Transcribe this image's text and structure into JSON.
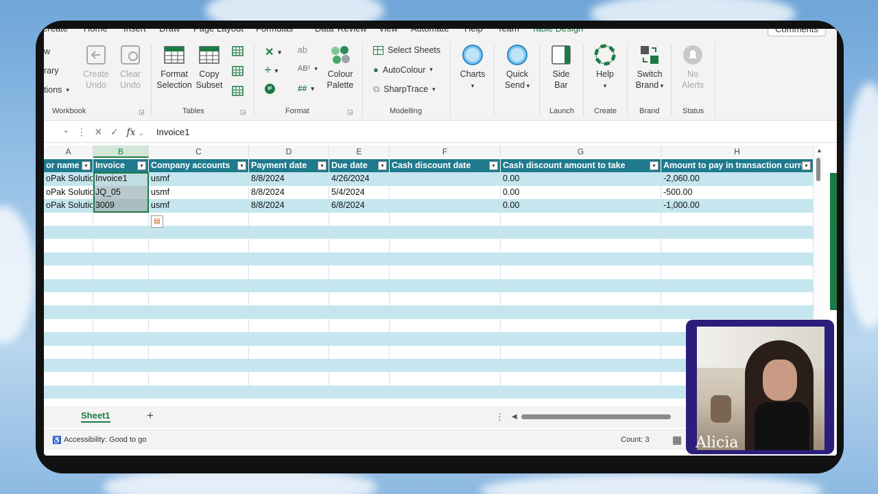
{
  "ribbon_tabs": [
    "Create",
    "Home",
    "Insert",
    "Draw",
    "Page Layout",
    "Formulas",
    "Data",
    "Review",
    "View",
    "Automate",
    "Help",
    "Team",
    "Table Design"
  ],
  "comments_label": "Comments",
  "left_partial": [
    "w",
    "rary",
    "tions"
  ],
  "groups": {
    "workbook": {
      "label": "Workbook",
      "create_undo": "Create\nUndo",
      "clear_undo": "Clear\nUndo"
    },
    "tables": {
      "label": "Tables",
      "format_selection": "Format\nSelection",
      "copy_subset": "Copy\nSubset"
    },
    "format": {
      "label": "Format",
      "colour_palette": "Colour\nPalette"
    },
    "modelling": {
      "label": "Modelling",
      "select_sheets": "Select Sheets",
      "autocolour": "AutoColour",
      "sharptrace": "SharpTrace",
      "charts": "Charts",
      "quick_send": "Quick\nSend"
    },
    "launch": {
      "label": "Launch",
      "side_bar": "Side\nBar"
    },
    "create": {
      "label": "Create",
      "help": "Help"
    },
    "brand": {
      "label": "Brand",
      "switch_brand": "Switch\nBrand"
    },
    "status": {
      "label": "Status",
      "no_alerts": "No\nAlerts"
    }
  },
  "formula": {
    "value": "Invoice1",
    "fx": "fx"
  },
  "columns": [
    "A",
    "B",
    "C",
    "D",
    "E",
    "F",
    "G",
    "H"
  ],
  "table": {
    "headers": [
      "or name",
      "Invoice",
      "Company accounts",
      "Payment date",
      "Due date",
      "Cash discount date",
      "Cash discount amount to take",
      "Amount to pay in transaction curren"
    ],
    "rows": [
      [
        "oPak Solution",
        "Invoice1",
        "usmf",
        "8/8/2024",
        "4/26/2024",
        "",
        "0.00",
        "-2,060.00"
      ],
      [
        "oPak Solution",
        "JQ_05",
        "usmf",
        "8/8/2024",
        "5/4/2024",
        "",
        "0.00",
        "-500.00"
      ],
      [
        "oPak Solution",
        "3009",
        "usmf",
        "8/8/2024",
        "6/8/2024",
        "",
        "0.00",
        "-1,000.00"
      ]
    ]
  },
  "sheet_tab": "Sheet1",
  "add_sheet": "+",
  "status": {
    "accessibility": "Accessibility: Good to go",
    "count": "Count: 3"
  },
  "webcam_name": "Alicia",
  "colors": {
    "header": "#1e7a8c",
    "band": "#c5e6ef",
    "accent": "#1e7a45"
  }
}
